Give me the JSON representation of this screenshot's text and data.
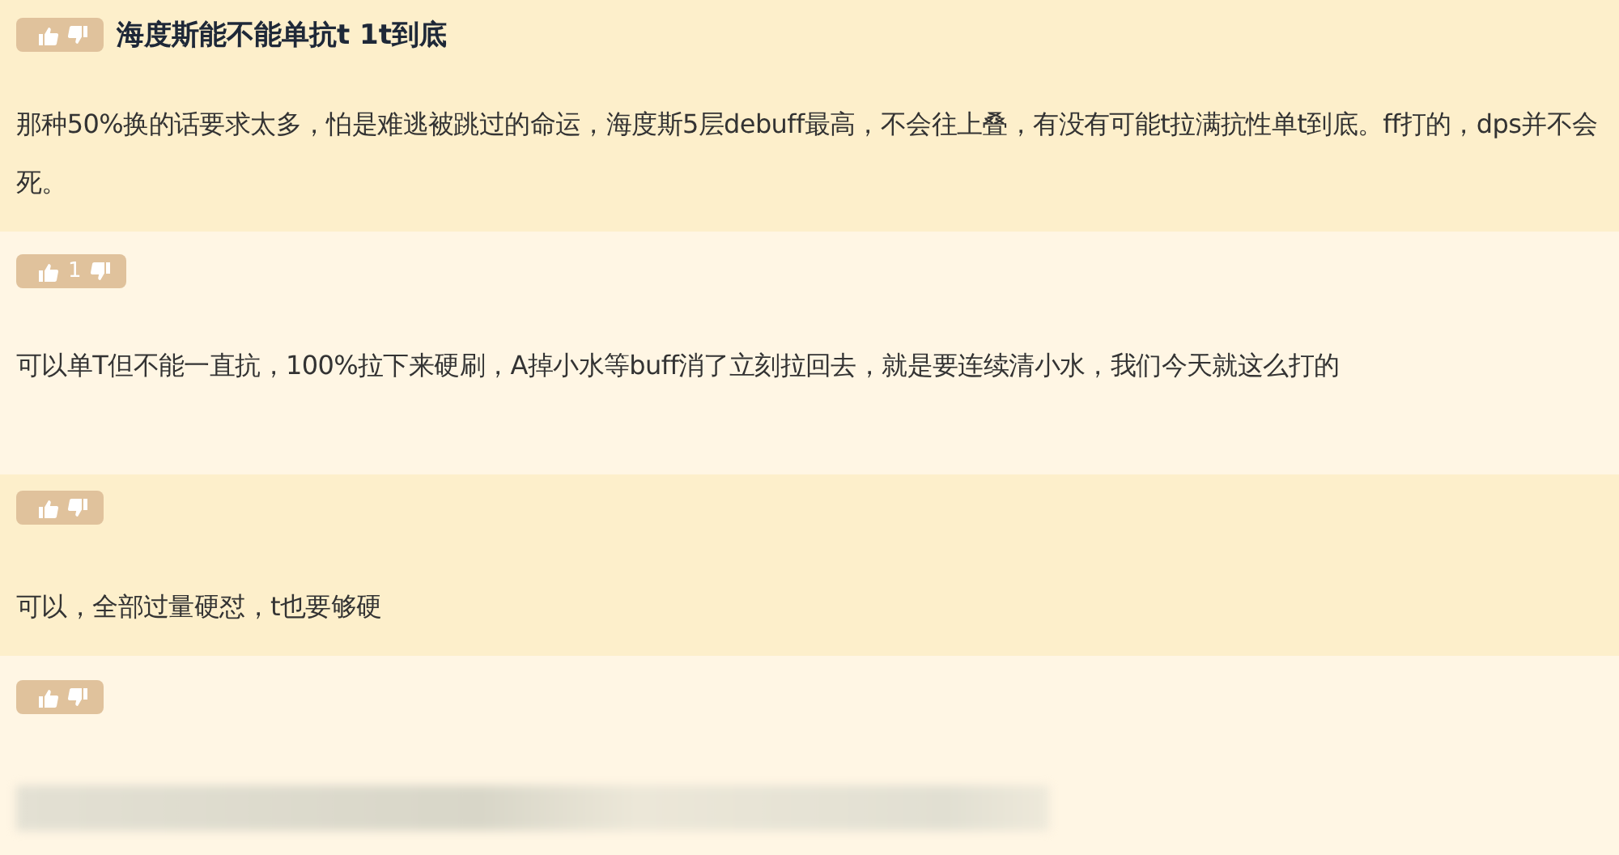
{
  "thread": {
    "title": "海度斯能不能单抗t  1t到底",
    "body": "那种50%换的话要求太多，怕是难逃被跳过的命运，海度斯5层debuff最高，不会往上叠，有没有可能t拉满抗性单t到底。ff打的，dps并不会死。"
  },
  "replies": [
    {
      "kind": "text",
      "votes": "1",
      "text": "可以单T但不能一直抗，100%拉下来硬刷，A掉小水等buff消了立刻拉回去，就是要连续清小水，我们今天就这么打的"
    },
    {
      "kind": "text",
      "text": "可以，全部过量硬怼，t也要够硬"
    },
    {
      "kind": "blurred"
    }
  ]
}
